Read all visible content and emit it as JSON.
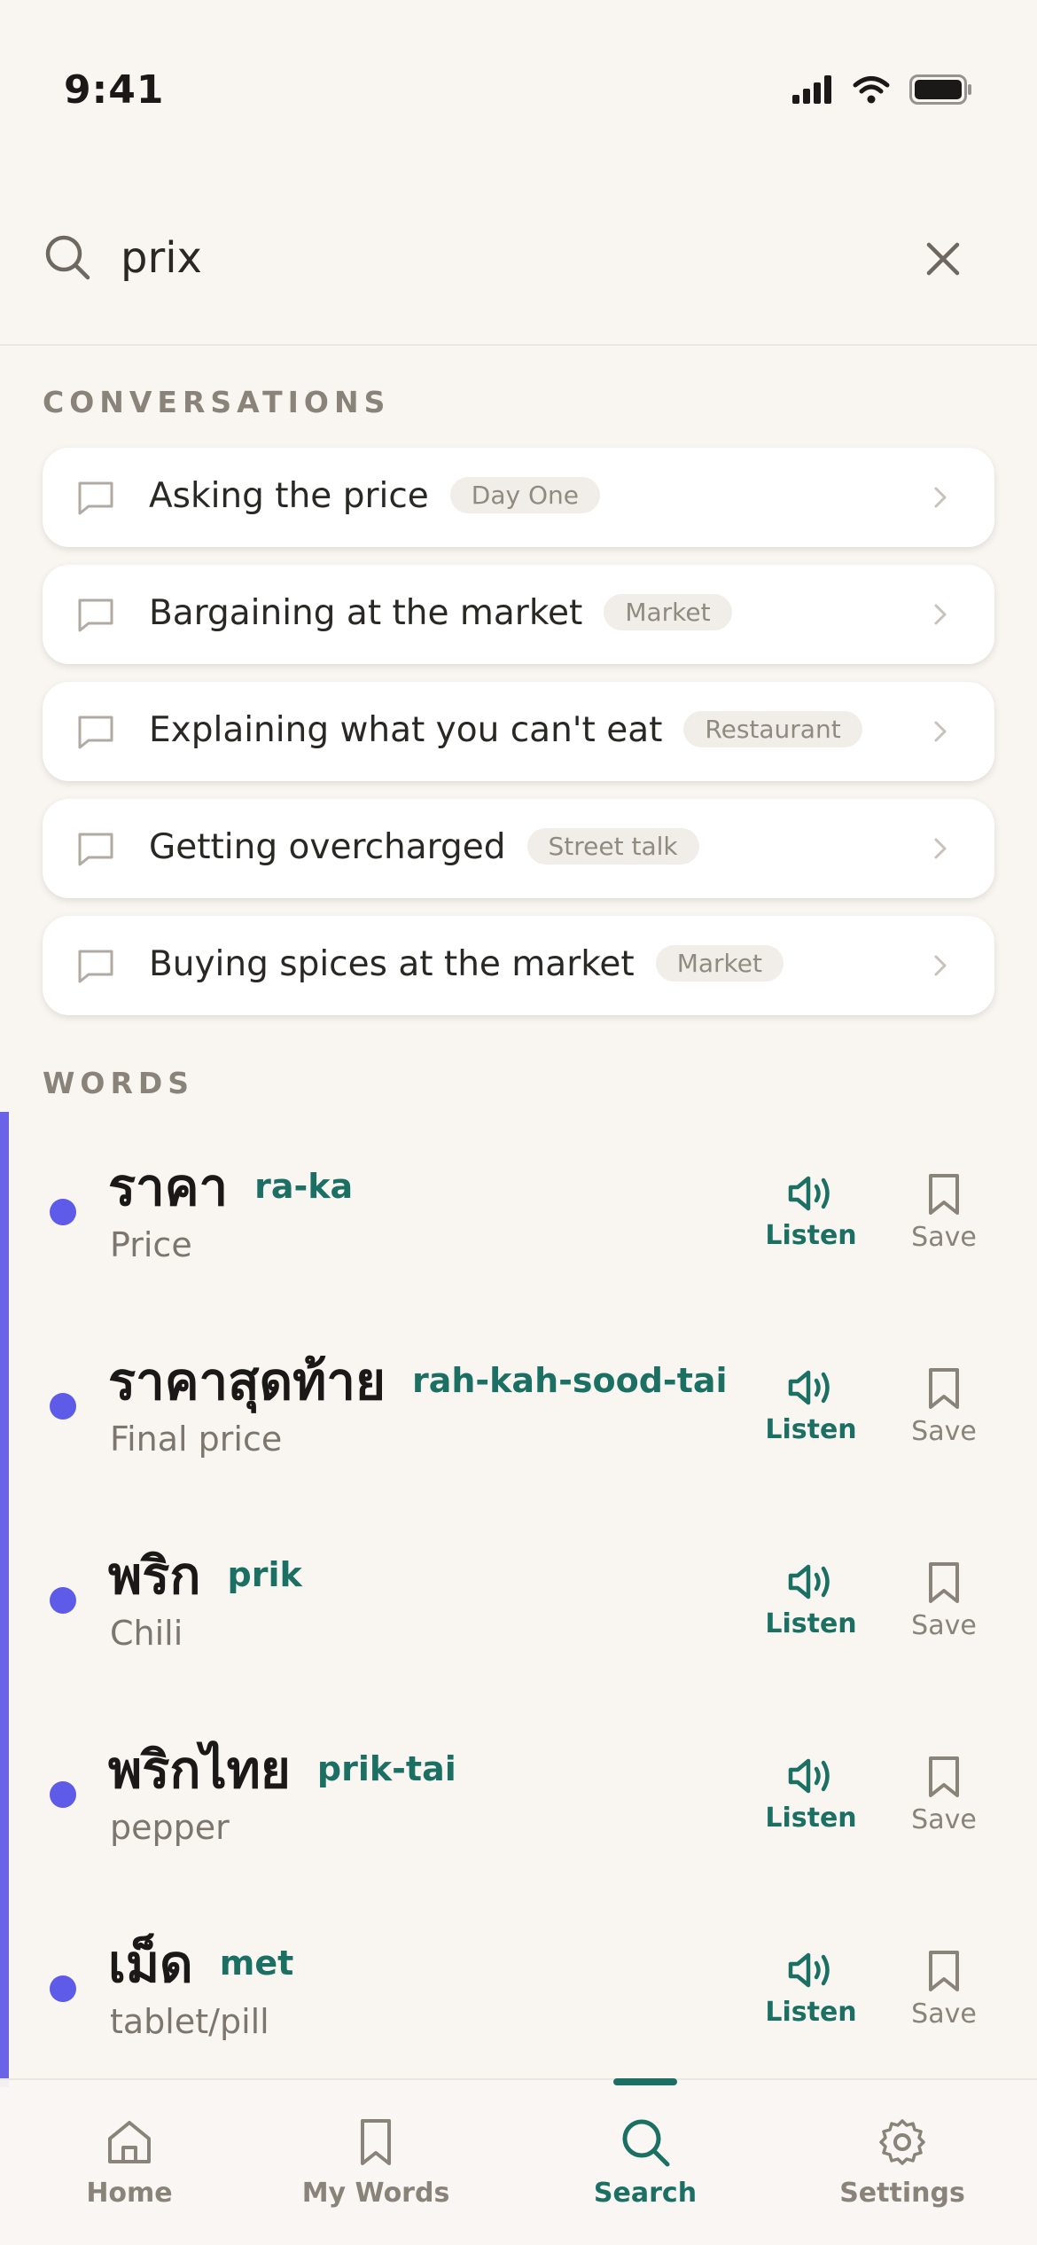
{
  "status": {
    "time": "9:41"
  },
  "search": {
    "query": "prix",
    "placeholder": ""
  },
  "sections": {
    "conversations": "CONVERSATIONS",
    "words": "WORDS"
  },
  "conversations": [
    {
      "title": "Asking the price",
      "tag": "Day One"
    },
    {
      "title": "Bargaining at the market",
      "tag": "Market"
    },
    {
      "title": "Explaining what you can't eat",
      "tag": "Restaurant"
    },
    {
      "title": "Getting overcharged",
      "tag": "Street talk"
    },
    {
      "title": "Buying spices at the market",
      "tag": "Market"
    }
  ],
  "words": [
    {
      "thai": "ราคา",
      "roman": "ra-ka",
      "meaning": "Price"
    },
    {
      "thai": "ราคาสุดท้าย",
      "roman": "rah-kah-sood-tai",
      "meaning": "Final price"
    },
    {
      "thai": "พริก",
      "roman": "prik",
      "meaning": "Chili"
    },
    {
      "thai": "พริกไทย",
      "roman": "prik-tai",
      "meaning": "pepper"
    },
    {
      "thai": "เม็ด",
      "roman": "met",
      "meaning": "tablet/pill"
    }
  ],
  "word_actions": {
    "listen": "Listen",
    "save": "Save"
  },
  "tabs": [
    {
      "label": "Home",
      "icon": "home-icon"
    },
    {
      "label": "My Words",
      "icon": "bookmark-icon"
    },
    {
      "label": "Search",
      "icon": "search-icon",
      "active": true
    },
    {
      "label": "Settings",
      "icon": "gear-icon"
    }
  ],
  "colors": {
    "background": "#f9f6f2",
    "accent_teal": "#1b6f63",
    "accent_indigo": "#5e5be8",
    "muted_text": "#8a837a",
    "tag_bg": "#f1eee9"
  }
}
